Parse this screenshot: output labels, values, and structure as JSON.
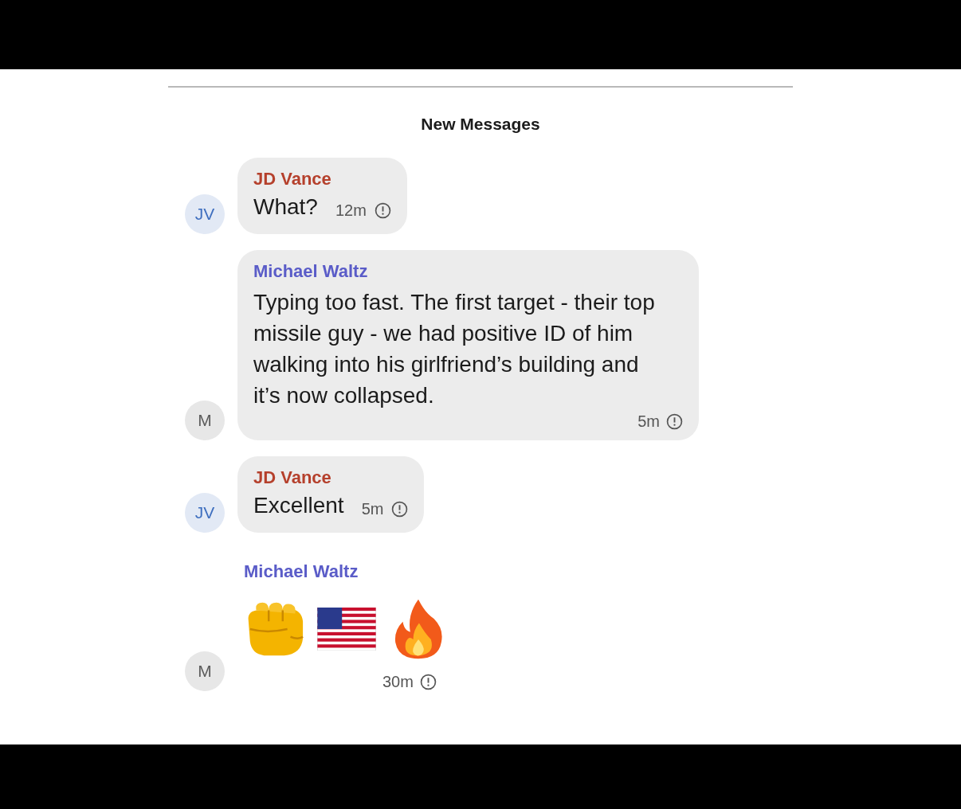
{
  "divider_label": "New Messages",
  "messages": [
    {
      "kind": "short",
      "sender": "JD Vance",
      "color": "#b5402c",
      "avatar": {
        "initials": "JV",
        "color": "#3f6fbf"
      },
      "text": "What?",
      "time": "12m"
    },
    {
      "kind": "long",
      "sender": "Michael Waltz",
      "color": "#5a5cc8",
      "avatar": {
        "initials": "M",
        "color": "#5c5c5c"
      },
      "text": "Typing too fast. The first target - their top missile guy - we had positive ID of him walking into his girlfriend’s building and it’s now collapsed.",
      "time": "5m"
    },
    {
      "kind": "short",
      "sender": "JD Vance",
      "color": "#b5402c",
      "avatar": {
        "initials": "JV",
        "color": "#3f6fbf"
      },
      "text": "Excellent",
      "time": "5m"
    },
    {
      "kind": "emoji",
      "sender": "Michael Waltz",
      "color": "#5a5cc8",
      "avatar": {
        "initials": "M",
        "color": "#5c5c5c"
      },
      "emojis": [
        {
          "kind": "fist"
        },
        {
          "kind": "flag"
        },
        {
          "kind": "fire"
        }
      ],
      "time": "30m"
    }
  ]
}
